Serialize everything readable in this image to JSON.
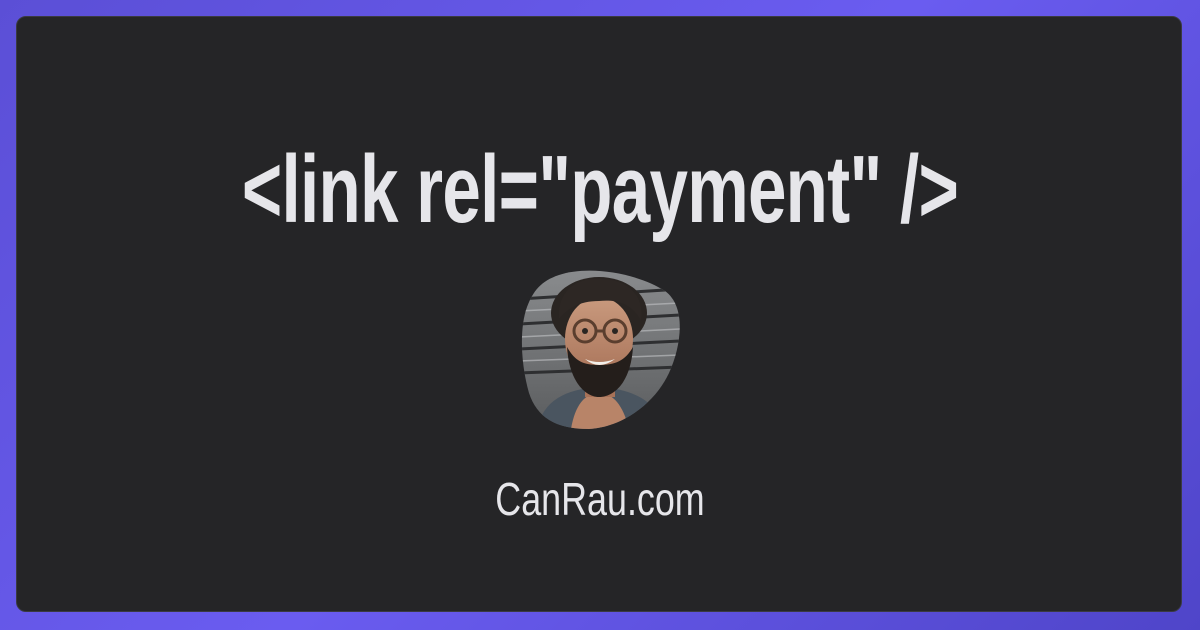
{
  "headline": "<link rel=\"payment\" />",
  "site": "CanRau.com",
  "colors": {
    "frame": "#5b4fd6",
    "card": "#252527",
    "text": "#e6e6ea"
  }
}
